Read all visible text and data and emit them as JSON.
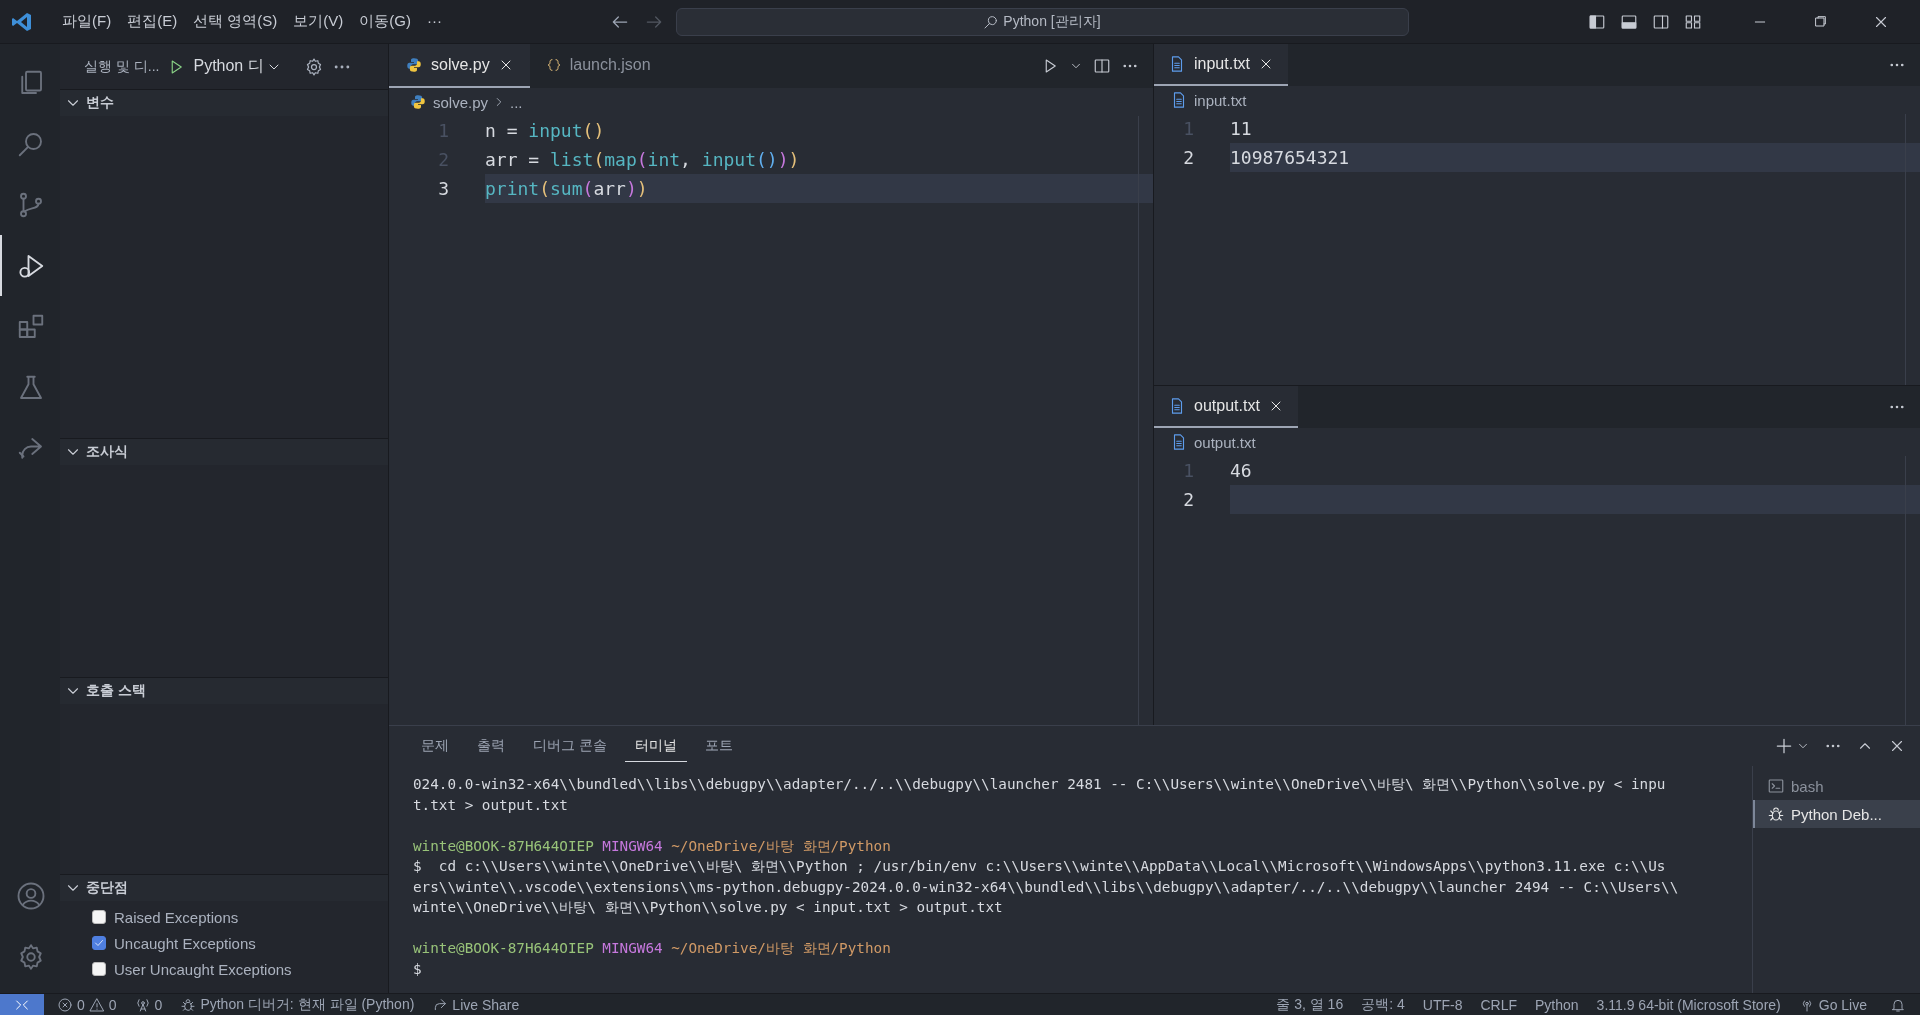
{
  "title_bar": {
    "menus": [
      "파일(F)",
      "편집(E)",
      "선택 영역(S)",
      "보기(V)",
      "이동(G)"
    ],
    "more": "···",
    "search": "Python [관리자]"
  },
  "activity_bar": {
    "top": [
      {
        "kind": "explorer",
        "selected": false
      },
      {
        "kind": "search",
        "selected": false
      },
      {
        "kind": "scm",
        "selected": false
      },
      {
        "kind": "debug",
        "selected": true
      },
      {
        "kind": "extensions",
        "selected": false
      },
      {
        "kind": "testing",
        "selected": false
      },
      {
        "kind": "liveshare",
        "selected": false
      }
    ],
    "bottom": [
      {
        "kind": "account"
      },
      {
        "kind": "settings"
      }
    ]
  },
  "sidebar": {
    "title": "실행 및 디...",
    "config": "Python 디",
    "sections": [
      {
        "title": "변수",
        "expanded": true
      },
      {
        "title": "조사식",
        "expanded": true
      },
      {
        "title": "호출 스택",
        "expanded": true
      },
      {
        "title": "중단점",
        "expanded": true,
        "items": [
          {
            "label": "Raised Exceptions",
            "checked": false
          },
          {
            "label": "Uncaught Exceptions",
            "checked": true
          },
          {
            "label": "User Uncaught Exceptions",
            "checked": false
          }
        ]
      }
    ]
  },
  "main_editor": {
    "tabs": [
      {
        "label": "solve.py",
        "kind": "python",
        "selected": true
      },
      {
        "label": "launch.json",
        "kind": "json",
        "selected": false
      }
    ],
    "breadcrumb": [
      "solve.py",
      "..."
    ],
    "lines": [
      {
        "number": "1",
        "current": false,
        "tokens": [
          {
            "kind": "plain",
            "text": "n = "
          },
          {
            "kind": "func",
            "text": "input"
          },
          {
            "kind": "p1",
            "text": "()"
          }
        ]
      },
      {
        "number": "2",
        "current": false,
        "tokens": [
          {
            "kind": "plain",
            "text": "arr = "
          },
          {
            "kind": "func",
            "text": "list"
          },
          {
            "kind": "p1",
            "text": "("
          },
          {
            "kind": "func",
            "text": "map"
          },
          {
            "kind": "p2",
            "text": "("
          },
          {
            "kind": "func",
            "text": "int"
          },
          {
            "kind": "plain",
            "text": ", "
          },
          {
            "kind": "func",
            "text": "input"
          },
          {
            "kind": "p3",
            "text": "()"
          },
          {
            "kind": "p2",
            "text": ")"
          },
          {
            "kind": "p1",
            "text": ")"
          }
        ]
      },
      {
        "number": "3",
        "current": true,
        "tokens": [
          {
            "kind": "func",
            "text": "print"
          },
          {
            "kind": "p1",
            "text": "("
          },
          {
            "kind": "func",
            "text": "sum"
          },
          {
            "kind": "p2",
            "text": "("
          },
          {
            "kind": "plain",
            "text": "arr"
          },
          {
            "kind": "p2",
            "text": ")"
          },
          {
            "kind": "p1",
            "text": ")"
          }
        ]
      }
    ]
  },
  "side_editors": [
    {
      "tab": "input.txt",
      "breadcrumb": "input.txt",
      "lines": [
        {
          "number": "1",
          "current": false,
          "text": "11"
        },
        {
          "number": "2",
          "current": true,
          "text": "10987654321"
        }
      ]
    },
    {
      "tab": "output.txt",
      "breadcrumb": "output.txt",
      "lines": [
        {
          "number": "1",
          "current": false,
          "text": "46"
        },
        {
          "number": "2",
          "current": true
        }
      ]
    }
  ],
  "panel": {
    "tabs": [
      {
        "label": "문제",
        "selected": false
      },
      {
        "label": "출력",
        "selected": false
      },
      {
        "label": "디버그 콘솔",
        "selected": false
      },
      {
        "label": "터미널",
        "selected": true
      },
      {
        "label": "포트",
        "selected": false
      }
    ],
    "terminal_blocks": [
      [
        [
          {
            "kind": "text",
            "text": "024.0.0-win32-x64\\\\bundled\\\\libs\\\\debugpy\\\\adapter/../..\\\\debugpy\\\\launcher 2481 -- C:\\\\Users\\\\winte\\\\OneDrive\\\\바탕\\ 화면\\\\Python\\\\solve.py < inpu"
          }
        ],
        [
          {
            "kind": "text",
            "text": "t.txt > output.txt"
          }
        ]
      ],
      [
        [
          {
            "kind": "user",
            "text": "winte@BOOK-87H644OIEP"
          },
          {
            "kind": "shell",
            "text": "MINGW64"
          },
          {
            "kind": "path",
            "text": "~/OneDrive/바탕 화면/Python"
          }
        ],
        [
          {
            "kind": "text",
            "text": "$  cd c:\\\\Users\\\\winte\\\\OneDrive\\\\바탕\\ 화면\\\\Python ; /usr/bin/env c:\\\\Users\\\\winte\\\\AppData\\\\Local\\\\Microsoft\\\\WindowsApps\\\\python3.11.exe c:\\\\Us"
          }
        ],
        [
          {
            "kind": "text",
            "text": "ers\\\\winte\\\\.vscode\\\\extensions\\\\ms-python.debugpy-2024.0.0-win32-x64\\\\bundled\\\\libs\\\\debugpy\\\\adapter/../..\\\\debugpy\\\\launcher 2494 -- C:\\\\Users\\\\"
          }
        ],
        [
          {
            "kind": "text",
            "text": "winte\\\\OneDrive\\\\바탕\\ 화면\\\\Python\\\\solve.py < input.txt > output.txt"
          }
        ]
      ],
      [
        [
          {
            "kind": "user",
            "text": "winte@BOOK-87H644OIEP"
          },
          {
            "kind": "shell",
            "text": "MINGW64"
          },
          {
            "kind": "path",
            "text": "~/OneDrive/바탕 화면/Python"
          }
        ],
        [
          {
            "kind": "text",
            "text": "$"
          }
        ]
      ]
    ],
    "terminals": [
      {
        "label": "bash",
        "kind": "shell",
        "selected": false
      },
      {
        "label": "Python Deb...",
        "kind": "debug",
        "selected": true
      }
    ]
  },
  "status_bar": {
    "left": [
      {
        "kind": "remote"
      },
      {
        "kind": "problems",
        "errors": "0",
        "warnings": "0"
      },
      {
        "kind": "ports",
        "text": "0"
      },
      {
        "kind": "debug",
        "text": "Python 디버거: 현재 파일 (Python)"
      },
      {
        "kind": "liveshare",
        "text": "Live Share"
      }
    ],
    "right": [
      {
        "kind": "text",
        "text": "줄 3, 열 16"
      },
      {
        "kind": "text",
        "text": "공백: 4"
      },
      {
        "kind": "text",
        "text": "UTF-8"
      },
      {
        "kind": "text",
        "text": "CRLF"
      },
      {
        "kind": "text",
        "text": "Python"
      },
      {
        "kind": "text",
        "text": "3.11.9 64-bit (Microsoft Store)"
      },
      {
        "kind": "golive",
        "text": "Go Live"
      },
      {
        "kind": "bell"
      }
    ]
  }
}
